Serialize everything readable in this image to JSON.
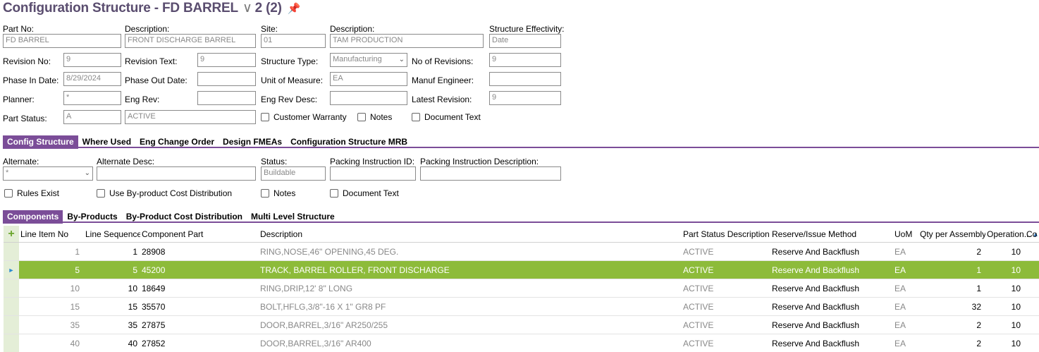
{
  "header": {
    "title": "Configuration Structure - FD BARREL",
    "config_id": "2 (2)"
  },
  "form": {
    "part_no": {
      "label": "Part No:",
      "value": "FD BARREL"
    },
    "description": {
      "label": "Description:",
      "value": "FRONT DISCHARGE BARREL"
    },
    "site": {
      "label": "Site:",
      "value": "01"
    },
    "site_description": {
      "label": "Description:",
      "value": "TAM PRODUCTION"
    },
    "structure_effectivity": {
      "label": "Structure Effectivity:",
      "value": "Date"
    },
    "revision_no": {
      "label": "Revision No:",
      "value": "9"
    },
    "revision_text": {
      "label": "Revision Text:",
      "value": "9"
    },
    "structure_type": {
      "label": "Structure Type:",
      "value": "Manufacturing"
    },
    "no_of_revisions": {
      "label": "No of Revisions:",
      "value": "9"
    },
    "phase_in_date": {
      "label": "Phase In Date:",
      "value": "8/29/2024"
    },
    "phase_out_date": {
      "label": "Phase Out Date:",
      "value": ""
    },
    "unit_of_measure": {
      "label": "Unit of Measure:",
      "value": "EA"
    },
    "manuf_engineer": {
      "label": "Manuf Engineer:",
      "value": ""
    },
    "planner": {
      "label": "Planner:",
      "value": "*"
    },
    "eng_rev": {
      "label": "Eng Rev:",
      "value": ""
    },
    "eng_rev_desc": {
      "label": "Eng Rev Desc:",
      "value": ""
    },
    "latest_revision": {
      "label": "Latest Revision:",
      "value": "9"
    },
    "part_status": {
      "label": "Part Status:",
      "value": "A",
      "desc": "ACTIVE"
    },
    "checks": {
      "customer_warranty": "Customer Warranty",
      "notes": "Notes",
      "document_text": "Document Text"
    }
  },
  "tabs1": [
    "Config Structure",
    "Where Used",
    "Eng Change Order",
    "Design FMEAs",
    "Configuration Structure MRB"
  ],
  "alt": {
    "alternate": {
      "label": "Alternate:",
      "value": "*"
    },
    "alternate_desc": {
      "label": "Alternate Desc:",
      "value": ""
    },
    "status": {
      "label": "Status:",
      "value": "Buildable"
    },
    "packing_id": {
      "label": "Packing Instruction ID:",
      "value": ""
    },
    "packing_desc": {
      "label": "Packing Instruction Description:",
      "value": ""
    },
    "checks": {
      "rules_exist": "Rules Exist",
      "byproduct": "Use By-product Cost Distribution",
      "notes": "Notes",
      "document_text": "Document Text"
    }
  },
  "tabs2": [
    "Components",
    "By-Products",
    "By-Product Cost Distribution",
    "Multi Level Structure"
  ],
  "grid": {
    "headers": {
      "line_item_no": "Line Item No",
      "line_sequence": "Line Sequence",
      "component_part": "Component Part",
      "description": "Description",
      "part_status_description": "Part Status Description",
      "reserve_issue_method": "Reserve/Issue Method",
      "uom": "UoM",
      "qty_per_assembly": "Qty per Assembly",
      "operation": "Operation...",
      "co": "Co"
    },
    "rows": [
      {
        "line": "1",
        "seq": "1",
        "part": "28908",
        "desc": "RING,NOSE,46\" OPENING,45 DEG.",
        "status": "ACTIVE",
        "method": "Reserve And Backflush",
        "uom": "EA",
        "qty": "2",
        "op": "10"
      },
      {
        "line": "5",
        "seq": "5",
        "part": "45200",
        "desc": "TRACK, BARREL ROLLER, FRONT DISCHARGE",
        "status": "ACTIVE",
        "method": "Reserve And Backflush",
        "uom": "EA",
        "qty": "1",
        "op": "10"
      },
      {
        "line": "10",
        "seq": "10",
        "part": "18649",
        "desc": "RING,DRIP,12' 8\" LONG",
        "status": "ACTIVE",
        "method": "Reserve And Backflush",
        "uom": "EA",
        "qty": "1",
        "op": "10"
      },
      {
        "line": "15",
        "seq": "15",
        "part": "35570",
        "desc": "BOLT,HFLG,3/8\"-16 X 1\" GR8 PF",
        "status": "ACTIVE",
        "method": "Reserve And Backflush",
        "uom": "EA",
        "qty": "32",
        "op": "10"
      },
      {
        "line": "35",
        "seq": "35",
        "part": "27875",
        "desc": "DOOR,BARREL,3/16\" AR250/255",
        "status": "ACTIVE",
        "method": "Reserve And Backflush",
        "uom": "EA",
        "qty": "2",
        "op": "10"
      },
      {
        "line": "40",
        "seq": "40",
        "part": "27852",
        "desc": "DOOR,BARREL,3/16\" AR400",
        "status": "ACTIVE",
        "method": "Reserve And Backflush",
        "uom": "EA",
        "qty": "2",
        "op": "10"
      }
    ]
  },
  "colors": {
    "accent": "#7b4d98",
    "selected_row": "#8dbb3a",
    "title": "#5a4d6f"
  }
}
